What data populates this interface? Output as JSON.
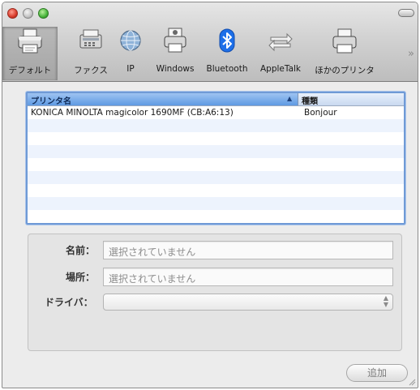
{
  "toolbar": {
    "items": [
      {
        "label": "デフォルト",
        "icon": "default-printer-icon"
      },
      {
        "label": "ファクス",
        "icon": "fax-icon"
      },
      {
        "label": "IP",
        "icon": "ip-globe-icon"
      },
      {
        "label": "Windows",
        "icon": "windows-printer-icon"
      },
      {
        "label": "Bluetooth",
        "icon": "bluetooth-icon"
      },
      {
        "label": "AppleTalk",
        "icon": "appletalk-icon"
      },
      {
        "label": "ほかのプリンタ",
        "icon": "other-printer-icon"
      }
    ],
    "overflow_glyph": "»"
  },
  "printer_list": {
    "columns": {
      "name": "プリンタ名",
      "kind": "種類"
    },
    "sort_glyph": "▲",
    "rows": [
      {
        "name": "KONICA MINOLTA magicolor 1690MF (CB:A6:13)",
        "kind": "Bonjour"
      }
    ]
  },
  "details": {
    "name_label": "名前：",
    "name_placeholder": "選択されていません",
    "location_label": "場所：",
    "location_placeholder": "選択されていません",
    "driver_label": "ドライバ：",
    "driver_value": ""
  },
  "add_button_label": "追加",
  "colors": {
    "selection_blue": "#5f9ae3",
    "alt_row": "#edf3fd",
    "bluetooth_blue": "#1d6fe8"
  }
}
